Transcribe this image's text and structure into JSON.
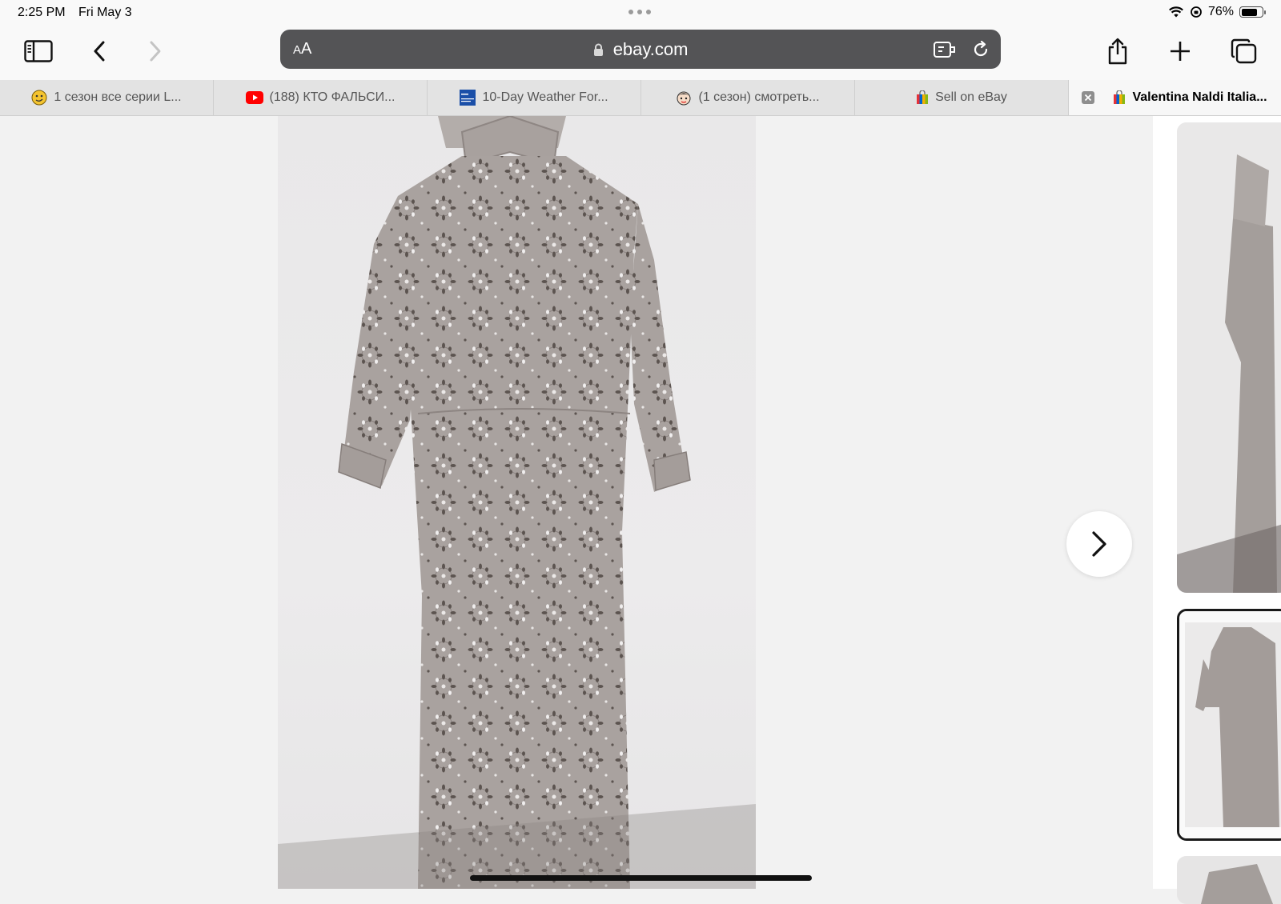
{
  "status_bar": {
    "time": "2:25 PM",
    "date": "Fri May 3",
    "battery_percent": "76%",
    "battery_level": 0.76
  },
  "address_bar": {
    "reader_label": "AA",
    "url": "ebay.com"
  },
  "tabs": [
    {
      "title": "1 сезон все серии L...",
      "favicon": "emoji-face-icon"
    },
    {
      "title": "(188) КТО ФАЛЬСИ...",
      "favicon": "youtube-icon"
    },
    {
      "title": "10-Day Weather For...",
      "favicon": "weather-channel-icon"
    },
    {
      "title": "(1 сезон) смотреть...",
      "favicon": "cartoon-face-icon"
    },
    {
      "title": "Sell on eBay",
      "favicon": "ebay-bag-icon"
    },
    {
      "title": "Valentina Naldi Italia...",
      "favicon": "ebay-bag-icon",
      "active": true
    }
  ],
  "colors": {
    "address_bar_bg": "#545456",
    "tab_bar_bg": "#e3e3e3",
    "active_tab_bg": "#f7f7f7",
    "page_bg": "#f2f2f2"
  }
}
